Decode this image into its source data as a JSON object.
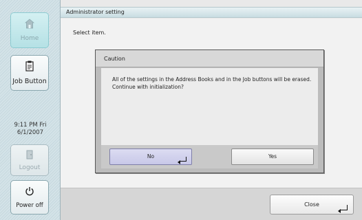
{
  "sidebar": {
    "home_label": "Home",
    "home_icon": "home-icon",
    "job_label": "Job Button",
    "job_icon": "job-clipboard-icon",
    "clock_time": "9:11 PM  Fri",
    "clock_date": "6/1/2007",
    "logout_label": "Logout",
    "logout_icon": "logout-door-icon",
    "power_label": "Power off",
    "power_icon": "power-icon"
  },
  "main": {
    "title": "Administrator setting",
    "instruction": "Select item.",
    "close_label": "Close"
  },
  "dialog": {
    "title": "Caution",
    "message": "All of the settings in the Address Books and in the Job buttons will be erased.  Continue with initialization?",
    "no_label": "No",
    "yes_label": "Yes"
  },
  "colors": {
    "sidebar_bg": "#d4e3e8",
    "home_active": "#b5e1e5",
    "no_button": "#c8c8e8"
  }
}
